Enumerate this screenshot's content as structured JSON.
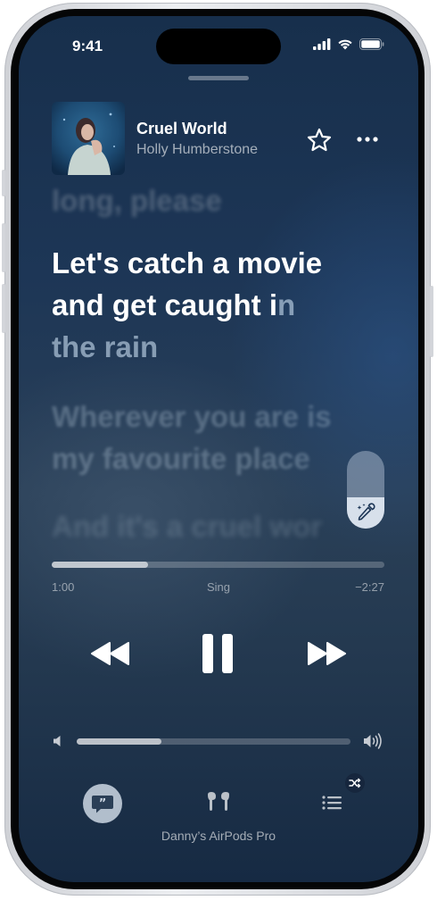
{
  "status_bar": {
    "time": "9:41",
    "icons": [
      "cellular-signal-icon",
      "wifi-icon",
      "battery-icon"
    ]
  },
  "now_playing": {
    "title": "Cruel World",
    "artist": "Holly Humberstone",
    "icons": {
      "favorite": "star-icon",
      "more": "ellipsis-icon"
    }
  },
  "lyrics": {
    "previous_line": "long, please",
    "current_line_1": "Let's catch a movie",
    "current_line_2_sung": "and get caught i",
    "current_line_2_upcoming": "n",
    "current_line_3": "the rain",
    "next_line_1": "Wherever you are is",
    "next_line_2": "my favourite place",
    "next_line_3": "And it's a cruel wor"
  },
  "sing_control": {
    "icon": "microphone-sparkle-icon",
    "level": 0.4
  },
  "playback": {
    "elapsed": "1:00",
    "mode_label": "Sing",
    "remaining": "−2:27",
    "progress": 0.29
  },
  "transport": {
    "icons": {
      "previous": "backward-icon",
      "play_pause": "pause-icon",
      "next": "forward-icon"
    }
  },
  "volume": {
    "level": 0.31,
    "icons": {
      "low": "speaker-low-icon",
      "high": "speaker-high-icon"
    }
  },
  "bottom_bar": {
    "icons": {
      "lyrics": "quote-bubble-icon",
      "airplay": "airpods-icon",
      "queue": "list-icon",
      "shuffle_badge": "shuffle-icon"
    },
    "device_name": "Danny’s AirPods Pro"
  },
  "colors": {
    "background_top": "#172f4c",
    "background_mid": "#2a4058",
    "text_primary": "#ffffff"
  }
}
